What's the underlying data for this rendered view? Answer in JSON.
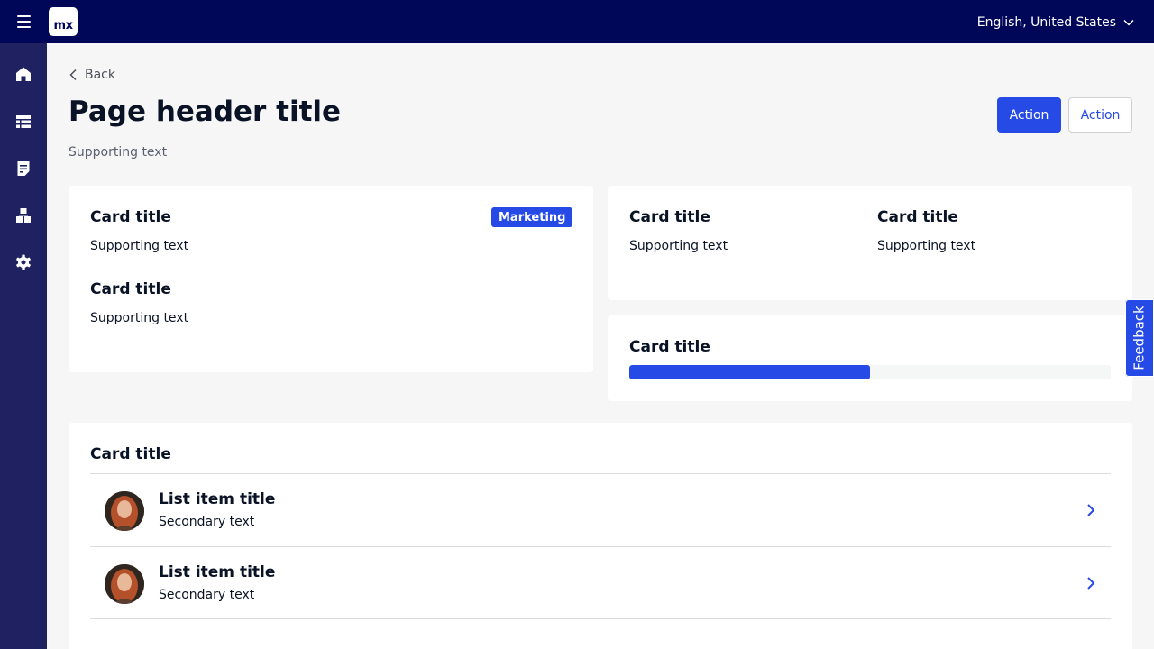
{
  "topbar": {
    "logo_text": "mx",
    "language": "English, United States"
  },
  "sidebar": {
    "items": [
      {
        "icon": "home-icon"
      },
      {
        "icon": "table-icon"
      },
      {
        "icon": "document-icon"
      },
      {
        "icon": "hierarchy-icon"
      },
      {
        "icon": "settings-icon"
      }
    ]
  },
  "header": {
    "back_label": "Back",
    "title": "Page header title",
    "supporting_text": "Supporting text",
    "primary_action": "Action",
    "secondary_action": "Action"
  },
  "card_left": {
    "title_1": "Card title",
    "badge": "Marketing",
    "sub_1": "Supporting text",
    "title_2": "Card title",
    "sub_2": "Supporting text"
  },
  "card_right_top": {
    "title_1": "Card title",
    "sub_1": "Supporting text",
    "title_2": "Card title",
    "sub_2": "Supporting text"
  },
  "card_progress": {
    "title": "Card title",
    "progress_fraction": 0.5
  },
  "card_list": {
    "title": "Card title",
    "items": [
      {
        "title": "List item title",
        "secondary": "Secondary text"
      },
      {
        "title": "List item title",
        "secondary": "Secondary text"
      }
    ]
  },
  "feedback": {
    "label": "Feedback"
  },
  "colors": {
    "topbar": "#000759",
    "sidebar": "#1f2161",
    "accent": "#264ae5"
  }
}
